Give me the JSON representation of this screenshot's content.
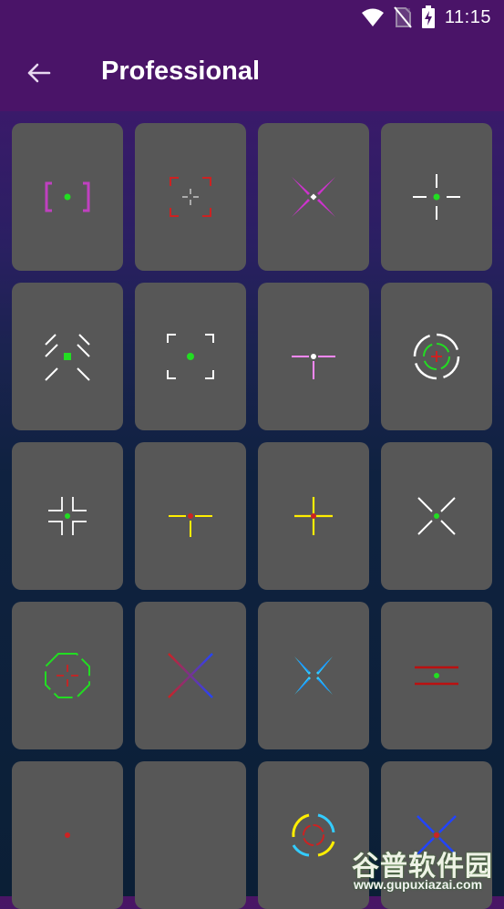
{
  "status_bar": {
    "time": "11:15",
    "icons": [
      "wifi-icon",
      "no-sim-icon",
      "battery-charging-icon"
    ]
  },
  "app_bar": {
    "back_icon": "arrow-left-icon",
    "title": "Professional"
  },
  "crosshairs": [
    {
      "id": "bracket-dot",
      "colors": [
        "#c040c0",
        "#22dd22"
      ]
    },
    {
      "id": "red-corners-cross",
      "colors": [
        "#cc2222",
        "#ffffff"
      ]
    },
    {
      "id": "magenta-x-spikes",
      "colors": [
        "#cc33cc",
        "#ffffff"
      ]
    },
    {
      "id": "white-plus-gap",
      "colors": [
        "#ffffff",
        "#22dd22"
      ]
    },
    {
      "id": "white-diagonal-square",
      "colors": [
        "#ffffff",
        "#22dd22"
      ]
    },
    {
      "id": "white-corners-dot",
      "colors": [
        "#ffffff",
        "#22dd22"
      ]
    },
    {
      "id": "pink-t",
      "colors": [
        "#ff88ff",
        "#ffffff"
      ]
    },
    {
      "id": "white-circle-green",
      "colors": [
        "#ffffff",
        "#22dd22",
        "#cc2222"
      ]
    },
    {
      "id": "white-brackets-four",
      "colors": [
        "#ffffff",
        "#22dd22"
      ]
    },
    {
      "id": "yellow-t-small",
      "colors": [
        "#ffee00",
        "#cc2222"
      ]
    },
    {
      "id": "yellow-plus",
      "colors": [
        "#ffee00",
        "#cc2222"
      ]
    },
    {
      "id": "white-x-dot",
      "colors": [
        "#ffffff",
        "#22dd22"
      ]
    },
    {
      "id": "green-octagon",
      "colors": [
        "#22dd22",
        "#cc2222"
      ]
    },
    {
      "id": "red-blue-x",
      "colors": [
        "#cc2222",
        "#2244ff"
      ]
    },
    {
      "id": "cyan-x",
      "colors": [
        "#33ccff",
        "#1188ff"
      ]
    },
    {
      "id": "red-double-line",
      "colors": [
        "#bb1111",
        "#22dd22"
      ]
    },
    {
      "id": "blue-cyan-bars",
      "colors": [
        "#2244ff",
        "#33ccff",
        "#cc2222"
      ]
    },
    {
      "id": "cyan-blue-plus",
      "colors": [
        "#33ccff",
        "#2244ff"
      ]
    },
    {
      "id": "rainbow-circle",
      "colors": [
        "#ffee00",
        "#33ccff",
        "#cc2222"
      ]
    },
    {
      "id": "blue-x-partial",
      "colors": [
        "#2244ff",
        "#cc2222"
      ]
    }
  ],
  "watermark": {
    "top": "谷普软件园",
    "bottom": "www.gupuxiazai.com"
  }
}
